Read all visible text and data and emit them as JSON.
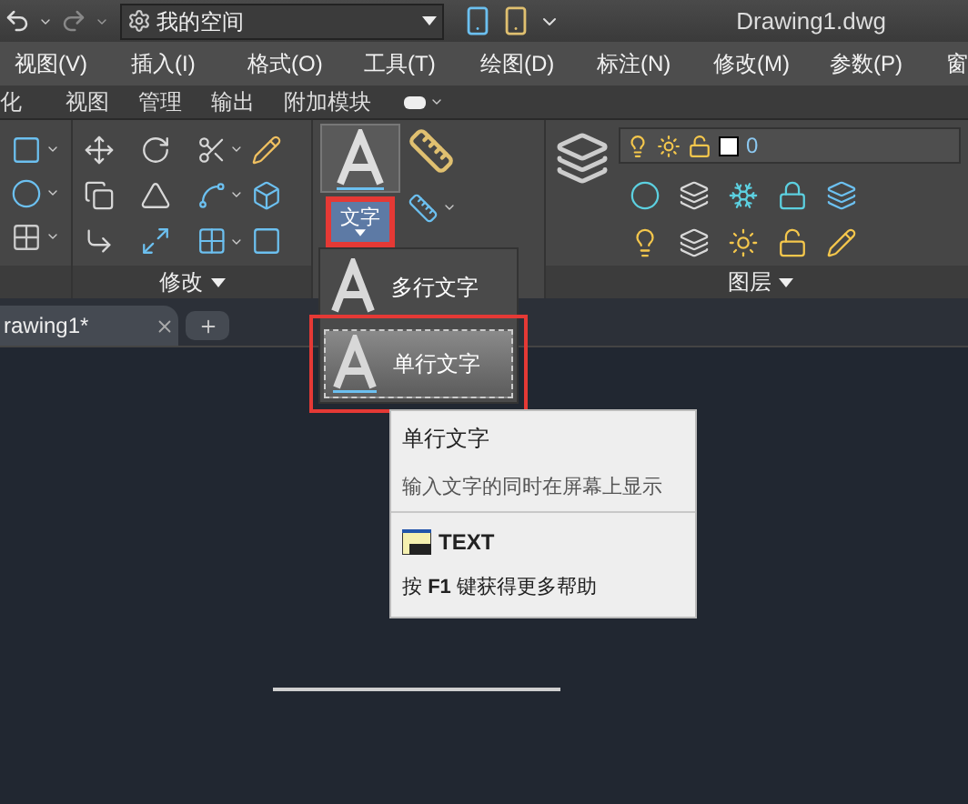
{
  "title_bar": {
    "workspace": "我的空间",
    "document_title": "Drawing1.dwg"
  },
  "menu": [
    "视图(V)",
    "插入(I)",
    "格式(O)",
    "工具(T)",
    "绘图(D)",
    "标注(N)",
    "修改(M)",
    "参数(P)",
    "窗"
  ],
  "ribbon_tabs": [
    "化",
    "视图",
    "管理",
    "输出",
    "附加模块"
  ],
  "panels": {
    "modify_label": "修改",
    "layers_label": "图层",
    "text_button": "文字",
    "layer_combo": "0"
  },
  "file_tabs": [
    {
      "label": "rawing1*"
    }
  ],
  "text_menu": [
    {
      "label": "多行文字",
      "selected": false
    },
    {
      "label": "单行文字",
      "selected": true
    }
  ],
  "tooltip": {
    "title": "单行文字",
    "description": "输入文字的同时在屏幕上显示",
    "command": "TEXT",
    "help": "按 **F1** 键获得更多帮助"
  }
}
